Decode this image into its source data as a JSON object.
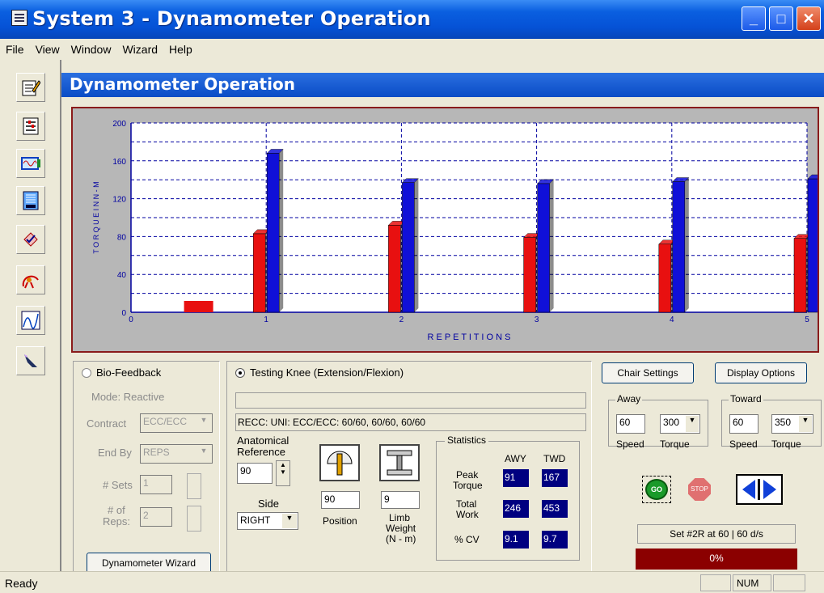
{
  "window": {
    "title": "System 3 - Dynamometer Operation"
  },
  "menu": [
    "File",
    "View",
    "Window",
    "Wizard",
    "Help"
  ],
  "header": {
    "title": "Dynamometer Operation"
  },
  "chart_data": {
    "type": "bar",
    "categories": [
      "1",
      "2",
      "3",
      "4",
      "5"
    ],
    "series": [
      {
        "color": "#e81010",
        "values": [
          83,
          92,
          79,
          72,
          78
        ]
      },
      {
        "color": "#1010d8",
        "values": [
          168,
          137,
          136,
          138,
          141
        ]
      }
    ],
    "pre_bar": {
      "x": 0.5,
      "value": 12,
      "color": "#e81010"
    },
    "xlabel": "R E P E T I T I O N S",
    "ylabel": "T O R Q U E   I N   N - M",
    "ylim": [
      0,
      200
    ],
    "yticks": [
      0,
      40,
      80,
      120,
      160,
      200
    ],
    "xticks": [
      "0",
      "1",
      "2",
      "3",
      "4",
      "5"
    ],
    "grid": true
  },
  "biofeedback": {
    "label": "Bio-Feedback",
    "mode": "Mode: Reactive",
    "contract_label": "Contract",
    "contract_value": "ECC/ECC",
    "endby_label": "End By",
    "endby_value": "REPS",
    "sets_label": "# Sets",
    "sets_value": "1",
    "reps_label1": "# of",
    "reps_label2": "Reps:",
    "reps_value": "2",
    "wizard_button": "Dynamometer Wizard"
  },
  "testing": {
    "label": "Testing Knee (Extension/Flexion)",
    "protocol": "RECC: UNI: ECC/ECC: 60/60, 60/60, 60/60",
    "anat_label1": "Anatomical",
    "anat_label2": "Reference",
    "anat_value": "90",
    "side_label": "Side",
    "side_value": "RIGHT",
    "position_value": "90",
    "position_label": "Position",
    "limb_value": "9",
    "limb_label1": "Limb",
    "limb_label2": "Weight",
    "limb_label3": "(N - m)"
  },
  "statistics": {
    "title": "Statistics",
    "col_awy": "AWY",
    "col_twd": "TWD",
    "peak_label1": "Peak",
    "peak_label2": "Torque",
    "peak_awy": "91",
    "peak_twd": "167",
    "work_label1": "Total",
    "work_label2": "Work",
    "work_awy": "246",
    "work_twd": "453",
    "cv_label": "% CV",
    "cv_awy": "9.1",
    "cv_twd": "9.7"
  },
  "right": {
    "chair_button": "Chair Settings",
    "display_button": "Display Options",
    "away_label": "Away",
    "away_speed": "60",
    "away_torque": "300",
    "toward_label": "Toward",
    "toward_speed": "60",
    "toward_torque": "350",
    "speed_label": "Speed",
    "torque_label": "Torque",
    "go_label": "GO",
    "stop_label": "STOP",
    "set_status": "Set #2R at 60 | 60 d/s",
    "progress_text": "0%",
    "progress_value": 0
  },
  "status": {
    "text": "Ready",
    "num": "NUM"
  },
  "colors": {
    "title_blue": "#0a52d6",
    "stat_box": "#000080",
    "progress": "#8b0000",
    "chart_bg": "#b7b7b7"
  }
}
